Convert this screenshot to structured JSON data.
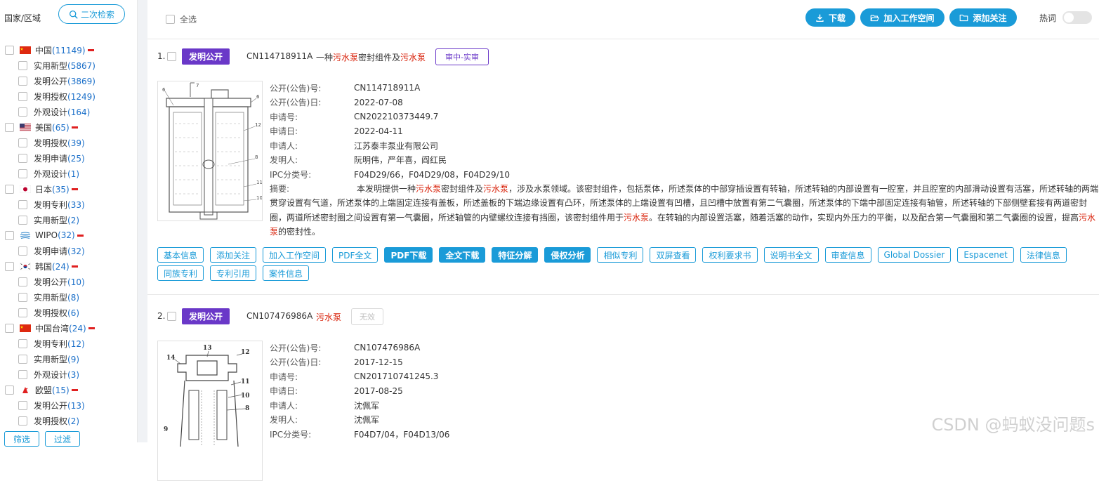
{
  "sidebar": {
    "title": "国家/区域",
    "secondary_search": "二次检索",
    "countries": [
      {
        "name": "中国",
        "count": "(11149)",
        "flag": "cn",
        "subs": [
          {
            "name": "实用新型",
            "count": "(5867)"
          },
          {
            "name": "发明公开",
            "count": "(3869)"
          },
          {
            "name": "发明授权",
            "count": "(1249)"
          },
          {
            "name": "外观设计",
            "count": "(164)"
          }
        ]
      },
      {
        "name": "美国",
        "count": "(65)",
        "flag": "us",
        "subs": [
          {
            "name": "发明授权",
            "count": "(39)"
          },
          {
            "name": "发明申请",
            "count": "(25)"
          },
          {
            "name": "外观设计",
            "count": "(1)"
          }
        ]
      },
      {
        "name": "日本",
        "count": "(35)",
        "flag": "jp",
        "subs": [
          {
            "name": "发明专利",
            "count": "(33)"
          },
          {
            "name": "实用新型",
            "count": "(2)"
          }
        ]
      },
      {
        "name": "WIPO",
        "count": "(32)",
        "flag": "wipo",
        "subs": [
          {
            "name": "发明申请",
            "count": "(32)"
          }
        ]
      },
      {
        "name": "韩国",
        "count": "(24)",
        "flag": "kr",
        "subs": [
          {
            "name": "发明公开",
            "count": "(10)"
          },
          {
            "name": "实用新型",
            "count": "(8)"
          },
          {
            "name": "发明授权",
            "count": "(6)"
          }
        ]
      },
      {
        "name": "中国台湾",
        "count": "(24)",
        "flag": "cn",
        "subs": [
          {
            "name": "发明专利",
            "count": "(12)"
          },
          {
            "name": "实用新型",
            "count": "(9)"
          },
          {
            "name": "外观设计",
            "count": "(3)"
          }
        ]
      },
      {
        "name": "欧盟",
        "count": "(15)",
        "flag": "eu",
        "subs": [
          {
            "name": "发明公开",
            "count": "(13)"
          },
          {
            "name": "发明授权",
            "count": "(2)"
          }
        ]
      }
    ],
    "filter_label": "筛选",
    "exclude_label": "过滤"
  },
  "toolbar": {
    "select_all": "全选",
    "download": "下载",
    "add_workspace": "加入工作空间",
    "add_follow": "添加关注",
    "hot_words": "热词"
  },
  "results": [
    {
      "index": "1.",
      "type": "发明公开",
      "pub_no": "CN114718911A",
      "title_parts": [
        {
          "t": "一种",
          "hl": false
        },
        {
          "t": "污水泵",
          "hl": true
        },
        {
          "t": "密封组件及",
          "hl": false
        },
        {
          "t": "污水泵",
          "hl": true
        }
      ],
      "status": "审中-实审",
      "fields": [
        {
          "k": "公开(公告)号:",
          "v": "CN114718911A"
        },
        {
          "k": "公开(公告)日:",
          "v": "2022-07-08"
        },
        {
          "k": "申请号:",
          "v": "CN202210373449.7"
        },
        {
          "k": "申请日:",
          "v": "2022-04-11"
        },
        {
          "k": "申请人:",
          "v": "江苏泰丰泵业有限公司"
        },
        {
          "k": "发明人:",
          "v": "阮明伟，严年喜，阎红民"
        },
        {
          "k": "IPC分类号:",
          "v": "F04D29/66，F04D29/08，F04D29/10"
        }
      ],
      "abstract_label": "摘要:",
      "abstract_parts": [
        {
          "t": "本发明提供一种",
          "hl": false
        },
        {
          "t": "污水泵",
          "hl": true
        },
        {
          "t": "密封组件及",
          "hl": false
        },
        {
          "t": "污水泵",
          "hl": true
        },
        {
          "t": "，涉及水泵领域。该密封组件，包括泵体，所述泵体的中部穿插设置有转轴，所述转轴的内部设置有一腔室，并且腔室的内部滑动设置有活塞，所述转轴的两端贯穿设置有气道，所述泵体的上端固定连接有盖板，所述盖板的下端边缘设置有凸环，所述泵体的上端设置有凹槽，且凹槽中放置有第二气囊圈，所述泵体的下端中部固定连接有轴管，所述转轴的下部侧壁套接有两道密封圈，两道所述密封圈之间设置有第一气囊圈，所述轴管的内壁螺纹连接有挡圈，该密封组件用于",
          "hl": false
        },
        {
          "t": "污水泵",
          "hl": true
        },
        {
          "t": "。在转轴的内部设置活塞，随着活塞的动作，实现内外压力的平衡，以及配合第一气囊圈和第二气囊圈的设置，提高",
          "hl": false
        },
        {
          "t": "污水泵",
          "hl": true
        },
        {
          "t": "的密封性。",
          "hl": false
        }
      ]
    },
    {
      "index": "2.",
      "type": "发明公开",
      "pub_no": "CN107476986A",
      "title_parts": [
        {
          "t": "污水泵",
          "hl": true
        }
      ],
      "status": "无效",
      "fields": [
        {
          "k": "公开(公告)号:",
          "v": "CN107476986A"
        },
        {
          "k": "公开(公告)日:",
          "v": "2017-12-15"
        },
        {
          "k": "申请号:",
          "v": "CN201710741245.3"
        },
        {
          "k": "申请日:",
          "v": "2017-08-25"
        },
        {
          "k": "申请人:",
          "v": "沈佩军"
        },
        {
          "k": "发明人:",
          "v": "沈佩军"
        },
        {
          "k": "IPC分类号:",
          "v": "F04D7/04，F04D13/06"
        }
      ]
    }
  ],
  "action_buttons": [
    {
      "label": "基本信息",
      "solid": false
    },
    {
      "label": "添加关注",
      "solid": false
    },
    {
      "label": "加入工作空间",
      "solid": false
    },
    {
      "label": "PDF全文",
      "solid": false
    },
    {
      "label": "PDF下载",
      "solid": true
    },
    {
      "label": "全文下载",
      "solid": true
    },
    {
      "label": "特征分解",
      "solid": true
    },
    {
      "label": "侵权分析",
      "solid": true
    },
    {
      "label": "相似专利",
      "solid": false
    },
    {
      "label": "双屏查看",
      "solid": false
    },
    {
      "label": "权利要求书",
      "solid": false
    },
    {
      "label": "说明书全文",
      "solid": false
    },
    {
      "label": "审查信息",
      "solid": false
    },
    {
      "label": "Global Dossier",
      "solid": false
    },
    {
      "label": "Espacenet",
      "solid": false
    },
    {
      "label": "法律信息",
      "solid": false
    },
    {
      "label": "同族专利",
      "solid": false
    },
    {
      "label": "专利引用",
      "solid": false
    },
    {
      "label": "案件信息",
      "solid": false
    }
  ],
  "watermark": "CSDN @蚂蚁没问题s",
  "colors": {
    "accent": "#1a9bd8",
    "badge_purple": "#6a38c8",
    "highlight_red": "#d81e06",
    "count_blue": "#1a6fc9"
  }
}
